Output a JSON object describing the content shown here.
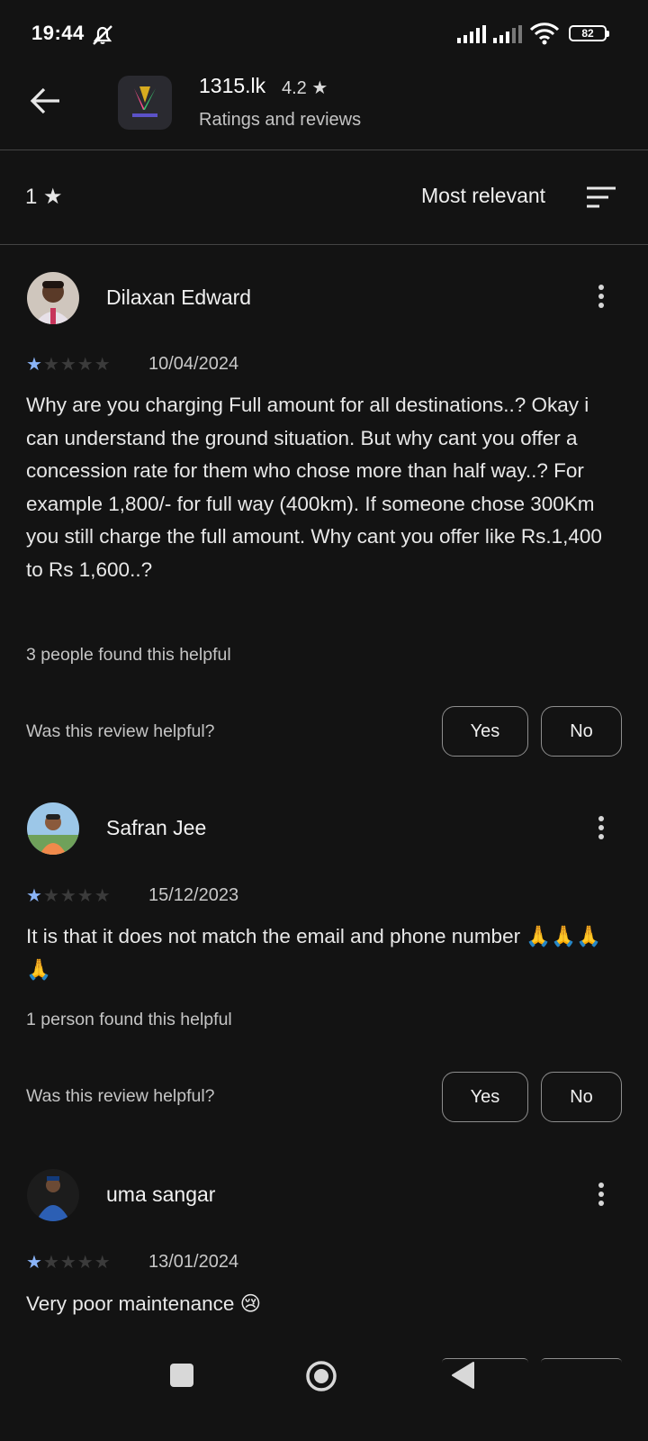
{
  "status_bar": {
    "time": "19:44",
    "battery": "82"
  },
  "header": {
    "app_name": "1315.lk",
    "app_rating": "4.2 ★",
    "subtitle": "Ratings and reviews"
  },
  "filter": {
    "stars_label": "1 ★",
    "sort_label": "Most relevant"
  },
  "reviews": [
    {
      "name": "Dilaxan Edward",
      "rating": 1,
      "date": "10/04/2024",
      "text": "Why are you charging Full amount for all destinations..? Okay i can understand the ground situation. But why cant you offer a concession rate for them who chose more than half way..? For example 1,800/- for full way (400km). If someone chose 300Km you still charge the full amount. Why cant you offer like Rs.1,400 to Rs 1,600..?",
      "helpful_count": "3 people found this helpful",
      "helpful_question": "Was this review helpful?",
      "yes_label": "Yes",
      "no_label": "No"
    },
    {
      "name": "Safran Jee",
      "rating": 1,
      "date": "15/12/2023",
      "text": "It is that it does not match the email and phone number 🙏🙏🙏🙏",
      "helpful_count": "1 person found this helpful",
      "helpful_question": "Was this review helpful?",
      "yes_label": "Yes",
      "no_label": "No"
    },
    {
      "name": "uma sangar",
      "rating": 1,
      "date": "13/01/2024",
      "text": "Very poor maintenance 😢"
    }
  ],
  "colors": {
    "background": "#131313",
    "star_active": "#8ab4f8",
    "star_inactive": "#3b3b3b"
  },
  "icons": [
    "mute-icon",
    "signal-icon",
    "wifi-icon",
    "battery-icon",
    "back-arrow-icon",
    "sort-icon",
    "more-vert-icon",
    "nav-recents-icon",
    "nav-home-icon",
    "nav-back-icon"
  ]
}
